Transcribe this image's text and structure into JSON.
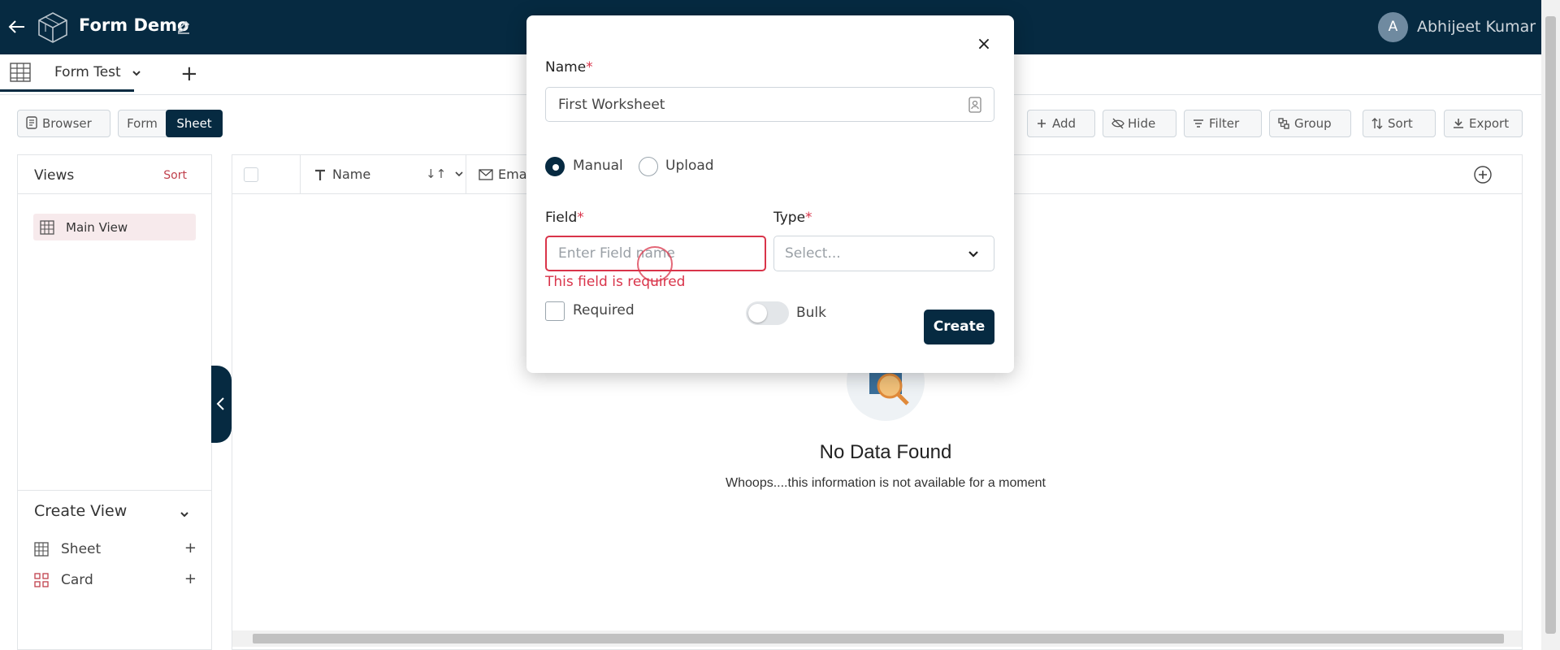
{
  "header": {
    "app_title": "Form Demo",
    "user_initial": "A",
    "user_name": "Abhijeet Kumar"
  },
  "tabs": {
    "active_tab": "Form Test",
    "add_label": "+"
  },
  "toolbar": {
    "browser": "Browser",
    "form": "Form",
    "sheet": "Sheet",
    "add": "Add",
    "hide": "Hide",
    "filter": "Filter",
    "group": "Group",
    "sort": "Sort",
    "export": "Export"
  },
  "views_panel": {
    "title": "Views",
    "sort": "Sort",
    "items": [
      {
        "label": "Main View"
      }
    ],
    "create_view": {
      "title": "Create View",
      "items": [
        {
          "label": "Sheet",
          "add": "+"
        },
        {
          "label": "Card",
          "add": "+"
        }
      ]
    }
  },
  "grid": {
    "columns": [
      {
        "label": "Name"
      },
      {
        "label": "Ema"
      }
    ],
    "sort_indicator": "↓↑",
    "empty_title": "No Data Found",
    "empty_subtitle": "Whoops....this information is not available for a moment"
  },
  "modal": {
    "close": "×",
    "name_label": "Name",
    "required_mark": "*",
    "name_value": "First Worksheet",
    "radio_options": [
      {
        "label": "Manual",
        "selected": true
      },
      {
        "label": "Upload",
        "selected": false
      }
    ],
    "field_label": "Field",
    "field_placeholder": "Enter Field name",
    "field_error": "This field is required",
    "type_label": "Type",
    "type_placeholder": "Select...",
    "required_checkbox": "Required",
    "bulk_toggle": "Bulk",
    "create_button": "Create"
  },
  "colors": {
    "primary": "#062a41",
    "error": "#d9344a",
    "sort_accent": "#c0404c",
    "selected_view_bg": "#f7eaec"
  }
}
